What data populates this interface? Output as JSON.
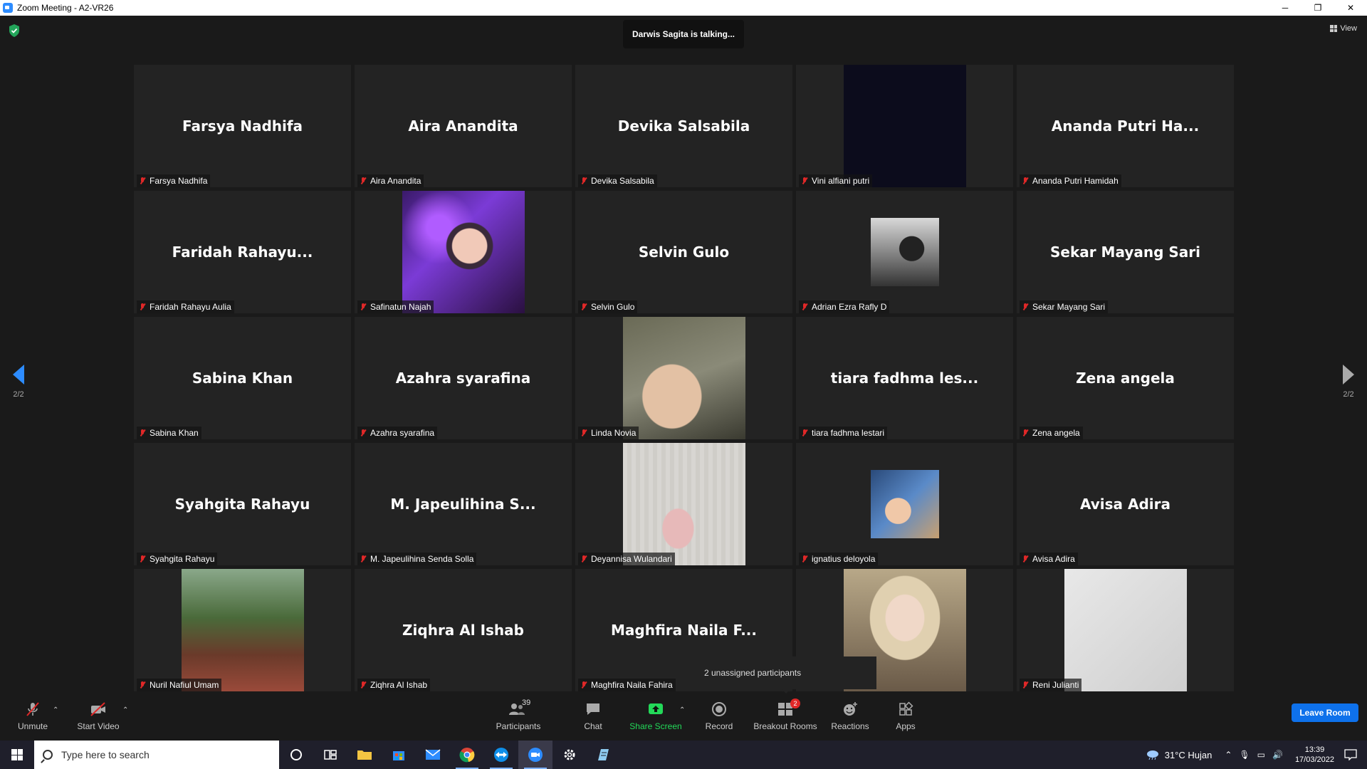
{
  "window": {
    "title": "Zoom Meeting - A2-VR26",
    "controls": [
      "─",
      "❐",
      "✕"
    ]
  },
  "meeting": {
    "talking_banner": "Darwis Sagita is talking...",
    "view_label": "View",
    "page_indicator_left": "2/2",
    "page_indicator_right": "2/2",
    "unassigned_popup": "2 unassigned participants"
  },
  "participants": [
    {
      "display": "Farsya Nadhifa",
      "tag": "Farsya Nadhifa"
    },
    {
      "display": "Aira Anandita",
      "tag": "Aira Anandita"
    },
    {
      "display": "Devika Salsabila",
      "tag": "Devika Salsabila"
    },
    {
      "display": "",
      "tag": "Vini alfiani putri"
    },
    {
      "display": "Ananda Putri Ha...",
      "tag": "Ananda Putri Hamidah"
    },
    {
      "display": "Faridah  Rahayu...",
      "tag": "Faridah Rahayu Aulia"
    },
    {
      "display": "",
      "tag": "Safinatun Najah"
    },
    {
      "display": "Selvin Gulo",
      "tag": "Selvin Gulo"
    },
    {
      "display": "",
      "tag": "Adrian Ezra Rafly D"
    },
    {
      "display": "Sekar Mayang Sari",
      "tag": "Sekar Mayang Sari"
    },
    {
      "display": "Sabina Khan",
      "tag": "Sabina Khan"
    },
    {
      "display": "Azahra syarafina",
      "tag": "Azahra syarafina"
    },
    {
      "display": "",
      "tag": "Linda Novia"
    },
    {
      "display": "tiara fadhma les...",
      "tag": "tiara fadhma lestari"
    },
    {
      "display": "Zena angela",
      "tag": "Zena angela"
    },
    {
      "display": "Syahgita Rahayu",
      "tag": "Syahgita Rahayu"
    },
    {
      "display": "M. Japeulihina S...",
      "tag": "M. Japeulihina Senda Solla"
    },
    {
      "display": "",
      "tag": "Deyannisa Wulandari"
    },
    {
      "display": "",
      "tag": "ignatius deloyola"
    },
    {
      "display": "Avisa Adira",
      "tag": "Avisa Adira"
    },
    {
      "display": "",
      "tag": "Nuril Nafiul Umam"
    },
    {
      "display": "Ziqhra Al Ishab",
      "tag": "Ziqhra Al Ishab"
    },
    {
      "display": "Maghfira Naila F...",
      "tag": "Maghfira Naila Fahira"
    },
    {
      "display": "",
      "tag": ""
    },
    {
      "display": "",
      "tag": "Reni Julianti"
    }
  ],
  "toolbar": {
    "unmute": "Unmute",
    "start_video": "Start Video",
    "participants": "Participants",
    "participants_count": "39",
    "chat": "Chat",
    "share_screen": "Share Screen",
    "record": "Record",
    "breakout_rooms": "Breakout Rooms",
    "breakout_badge": "2",
    "reactions": "Reactions",
    "apps": "Apps",
    "leave": "Leave Room"
  },
  "taskbar": {
    "search_placeholder": "Type here to search",
    "weather": "31°C  Hujan",
    "time": "13:39",
    "date": "17/03/2022"
  },
  "colors": {
    "accent": "#2d8cff",
    "leave": "#0e71eb",
    "muted": "#e02828",
    "share": "#23d959"
  }
}
